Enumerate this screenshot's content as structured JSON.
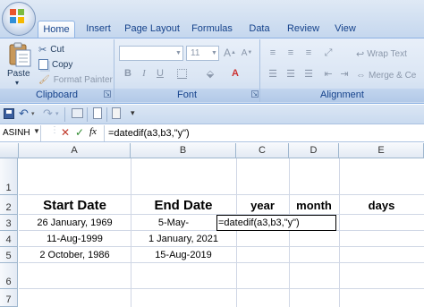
{
  "ribbon_tabs": [
    "Home",
    "Insert",
    "Page Layout",
    "Formulas",
    "Data",
    "Review",
    "View"
  ],
  "clipboard": {
    "paste": "Paste",
    "cut": "Cut",
    "copy": "Copy",
    "format_painter": "Format Painter",
    "group_label": "Clipboard"
  },
  "font": {
    "font_size": "11",
    "group_label": "Font"
  },
  "alignment": {
    "wrap_text": "Wrap Text",
    "merge_center": "Merge & Ce",
    "group_label": "Alignment"
  },
  "formula_bar": {
    "name_box": "ASINH",
    "fx": "fx",
    "formula": "=datedif(a3,b3,\"y\")"
  },
  "columns": [
    "A",
    "B",
    "C",
    "D",
    "E"
  ],
  "rows": [
    "1",
    "2",
    "3",
    "4",
    "5",
    "6",
    "7"
  ],
  "cells": {
    "A2": "Start Date",
    "B2": "End Date",
    "C2": "year",
    "D2": "month",
    "E2": "days",
    "A3": "26 January, 1969",
    "B3": "5-May-",
    "C3": "=datedif(a3,b3,\"y\")",
    "A4": "11-Aug-1999",
    "B4": "1 January, 2021",
    "A5": "2 October, 1986",
    "B5": "15-Aug-2019"
  }
}
